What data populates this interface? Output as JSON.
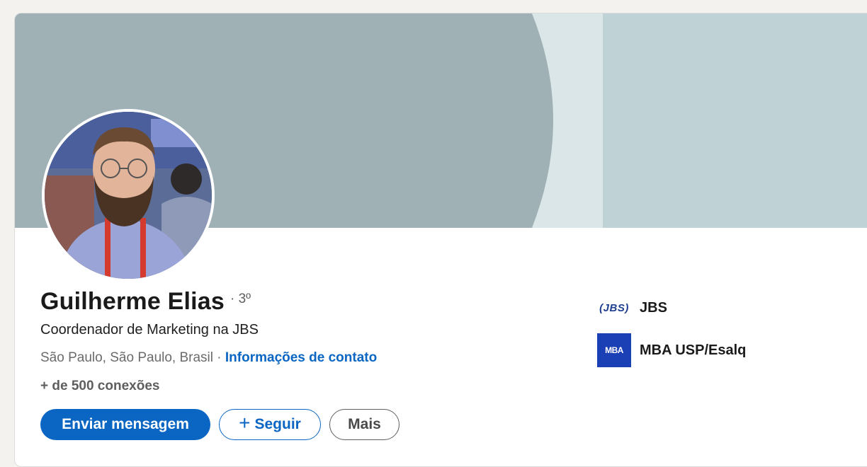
{
  "profile": {
    "name": "Guilherme Elias",
    "degree": "· 3º",
    "headline": "Coordenador de Marketing na JBS",
    "location": "São Paulo, São Paulo, Brasil",
    "separator": " · ",
    "contact_link": "Informações de contato",
    "connections": "+ de 500 conexões"
  },
  "actions": {
    "message_label": "Enviar mensagem",
    "follow_plus": "+",
    "follow_label": "Seguir",
    "more_label": "Mais"
  },
  "organizations": [
    {
      "logo_text": "(JBS)",
      "name": "JBS"
    },
    {
      "logo_text": "MBA",
      "name": "MBA USP/Esalq"
    }
  ],
  "colors": {
    "accent": "#0a66c2",
    "banner_light": "#bfd3d6",
    "banner_dark": "#9fb1b4"
  },
  "icons": {
    "follow": "plus-icon"
  }
}
